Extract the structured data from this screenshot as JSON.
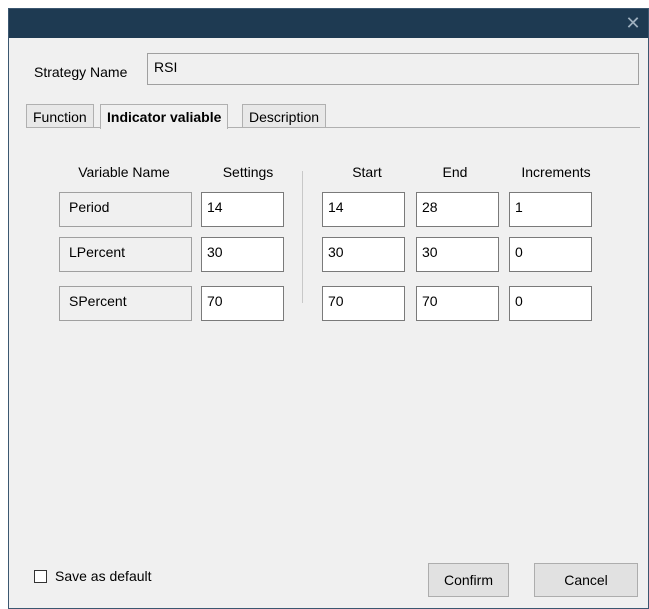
{
  "window": {
    "close_glyph": "✕"
  },
  "strategy": {
    "label": "Strategy Name",
    "value": "RSI"
  },
  "tabs": [
    {
      "label": "Function"
    },
    {
      "label": "Indicator valiable"
    },
    {
      "label": "Description"
    }
  ],
  "table": {
    "headers": {
      "variable_name": "Variable Name",
      "settings": "Settings",
      "start": "Start",
      "end": "End",
      "increments": "Increments"
    },
    "rows": [
      {
        "name": "Period",
        "settings": "14",
        "start": "14",
        "end": "28",
        "increments": "1"
      },
      {
        "name": "LPercent",
        "settings": "30",
        "start": "30",
        "end": "30",
        "increments": "0"
      },
      {
        "name": "SPercent",
        "settings": "70",
        "start": "70",
        "end": "70",
        "increments": "0"
      }
    ]
  },
  "footer": {
    "save_default_label": "Save as default",
    "confirm_label": "Confirm",
    "cancel_label": "Cancel"
  }
}
